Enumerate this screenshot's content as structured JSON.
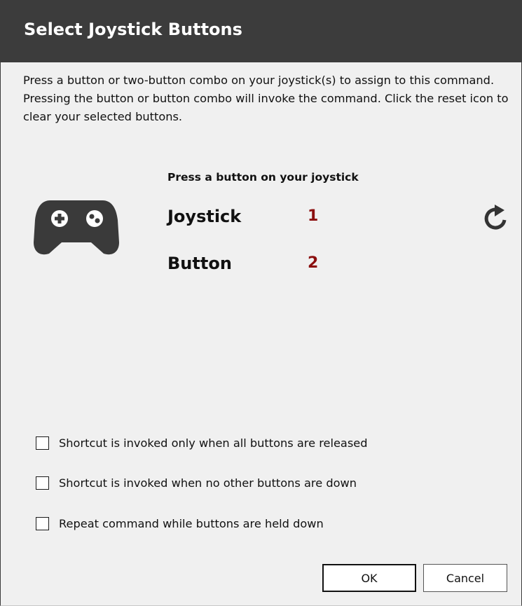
{
  "dialog": {
    "title": "Select Joystick Buttons",
    "description": "Press a button or two-button combo on your joystick(s) to assign to this command.  Pressing the button or button combo will invoke the command.  Click the reset icon to clear your selected buttons."
  },
  "capture": {
    "prompt": "Press a button on your joystick",
    "icon": "gamepad-icon",
    "joystick_label": "Joystick",
    "joystick_value": "1",
    "button_label": "Button",
    "button_value": "2",
    "reset_icon": "reset-icon",
    "value_color": "#8b0f0f"
  },
  "options": [
    {
      "label": "Shortcut is invoked only when all buttons are released",
      "checked": false
    },
    {
      "label": "Shortcut is invoked when no other buttons are down",
      "checked": false
    },
    {
      "label": "Repeat command while buttons are held down",
      "checked": false
    }
  ],
  "buttons": {
    "ok": "OK",
    "cancel": "Cancel"
  },
  "colors": {
    "titlebar": "#3c3c3c",
    "background": "#f0f0f0"
  }
}
